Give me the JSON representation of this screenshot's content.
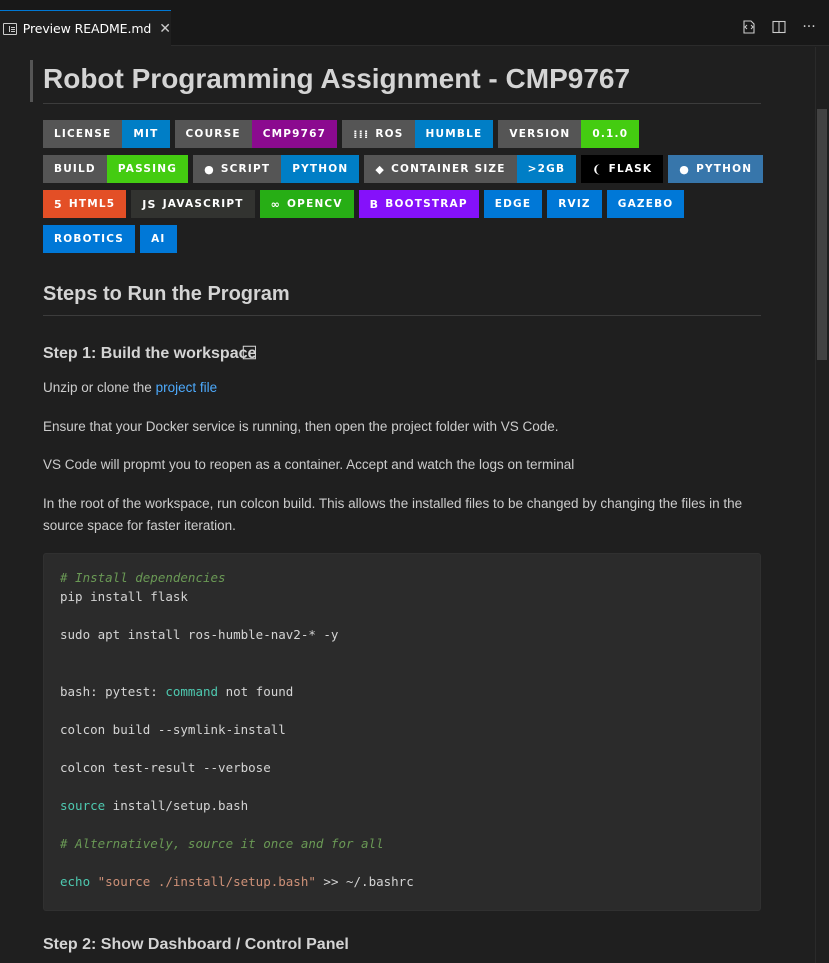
{
  "tab": {
    "label": "Preview README.md",
    "close": "✕"
  },
  "toolbar": {
    "open_source_icon": "open-source-icon",
    "split_icon": "split-editor-icon",
    "more_label": "···"
  },
  "document": {
    "title": "Robot Programming Assignment - CMP9767",
    "badges": [
      [
        {
          "label": "LICENSE",
          "value": "MIT",
          "color": "#007ec6"
        },
        {
          "label": "COURSE",
          "value": "CMP9767",
          "color": "#8b0a8f"
        },
        {
          "label": "ROS",
          "value": "HUMBLE",
          "color": "#007ec6",
          "icon": "⁞⁞⁞"
        },
        {
          "label": "VERSION",
          "value": "0.1.0",
          "color": "#4c1"
        }
      ],
      [
        {
          "label": "BUILD",
          "value": "PASSING",
          "color": "#4c1"
        },
        {
          "label": "SCRIPT",
          "value": "PYTHON",
          "color": "#007ec6",
          "icon": "●"
        },
        {
          "label": "CONTAINER SIZE",
          "value": ">2GB",
          "color": "#007ec6",
          "icon": "◆"
        },
        {
          "label": "",
          "value": "FLASK",
          "color": "#000000",
          "icon": "❨"
        },
        {
          "label": "",
          "value": "PYTHON",
          "color": "#3776ab",
          "icon": "●"
        }
      ],
      [
        {
          "label": "",
          "value": "HTML5",
          "color": "#e34f26",
          "icon": "5"
        },
        {
          "label": "",
          "value": "JAVASCRIPT",
          "color": "#323330",
          "icon": "JS"
        },
        {
          "label": "",
          "value": "OPENCV",
          "color": "#27ae15",
          "icon": "∞"
        },
        {
          "label": "",
          "value": "BOOTSTRAP",
          "color": "#8511fa",
          "icon": "B"
        },
        {
          "label": "",
          "value": "EDGE",
          "color": "#0078d7"
        },
        {
          "label": "",
          "value": "RVIZ",
          "color": "#0078d7"
        },
        {
          "label": "",
          "value": "GAZEBO",
          "color": "#0078d7"
        }
      ],
      [
        {
          "label": "",
          "value": "ROBOTICS",
          "color": "#0078d7"
        },
        {
          "label": "",
          "value": "AI",
          "color": "#0078d7"
        }
      ]
    ],
    "section_title": "Steps to Run the Program",
    "step1_title": "Step 1: Build the workspace",
    "step1_glyph": "⃞",
    "p1_prefix": "Unzip or clone the ",
    "p1_link": "project file",
    "p2": "Ensure that your Docker service is running, then open the project folder with VS Code.",
    "p3": "VS Code will propmt you to reopen as a container. Accept and watch the logs on terminal",
    "p4": "In the root of the workspace, run colcon build. This allows the installed files to be changed by changing the files in the source space for faster iteration.",
    "code": {
      "l1": "# Install dependencies",
      "l2": "pip install flask",
      "l3": "sudo apt install ros-humble-nav2-* -y",
      "l4a": "bash: pytest: ",
      "l4b": "command",
      "l4c": " not found",
      "l5": "colcon build --symlink-install",
      "l6": "colcon test-result --verbose",
      "l7a": "source",
      "l7b": " install/setup.bash",
      "l8": "# Alternatively, source it once and for all",
      "l9a": "echo",
      "l9b": " \"source ./install/setup.bash\"",
      "l9c": " >> ~/.bashrc"
    },
    "step2_title": "Step 2: Show Dashboard / Control Panel"
  }
}
